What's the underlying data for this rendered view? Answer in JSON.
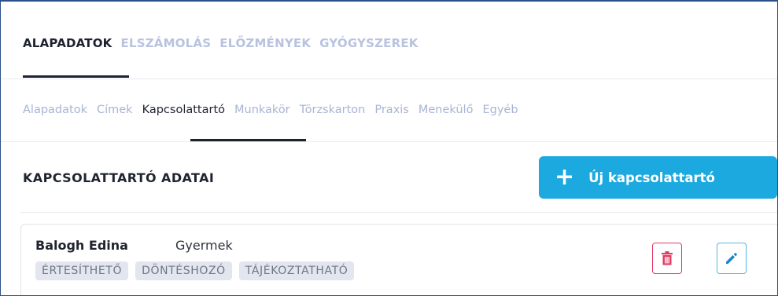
{
  "top_tabs": [
    {
      "label": "ALAPADATOK",
      "active": true
    },
    {
      "label": "ELSZÁMOLÁS",
      "active": false
    },
    {
      "label": "ELŐZMÉNYEK",
      "active": false
    },
    {
      "label": "GYÓGYSZEREK",
      "active": false
    }
  ],
  "sub_tabs": [
    {
      "label": "Alapadatok",
      "active": false
    },
    {
      "label": "Címek",
      "active": false
    },
    {
      "label": "Kapcsolattartó",
      "active": true
    },
    {
      "label": "Munkakör",
      "active": false
    },
    {
      "label": "Törzskarton",
      "active": false
    },
    {
      "label": "Praxis",
      "active": false
    },
    {
      "label": "Menekülő",
      "active": false
    },
    {
      "label": "Egyéb",
      "active": false
    }
  ],
  "section": {
    "title": "KAPCSOLATTARTÓ ADATAI",
    "new_button_label": "Új kapcsolattartó",
    "new_button_icon": "plus-icon"
  },
  "contact": {
    "name": "Balogh Edina",
    "relation": "Gyermek",
    "tags": [
      "ÉRTESÍTHETŐ",
      "DÖNTÉSHOZÓ",
      "TÁJÉKOZTATHATÓ"
    ],
    "delete_icon": "trash-icon",
    "edit_icon": "pencil-icon"
  },
  "colors": {
    "accent": "#1ca9df",
    "active_text": "#1e2230",
    "inactive_tab": "#b9c2de",
    "danger": "#e03b61",
    "tag_bg": "#e3e6ee"
  }
}
